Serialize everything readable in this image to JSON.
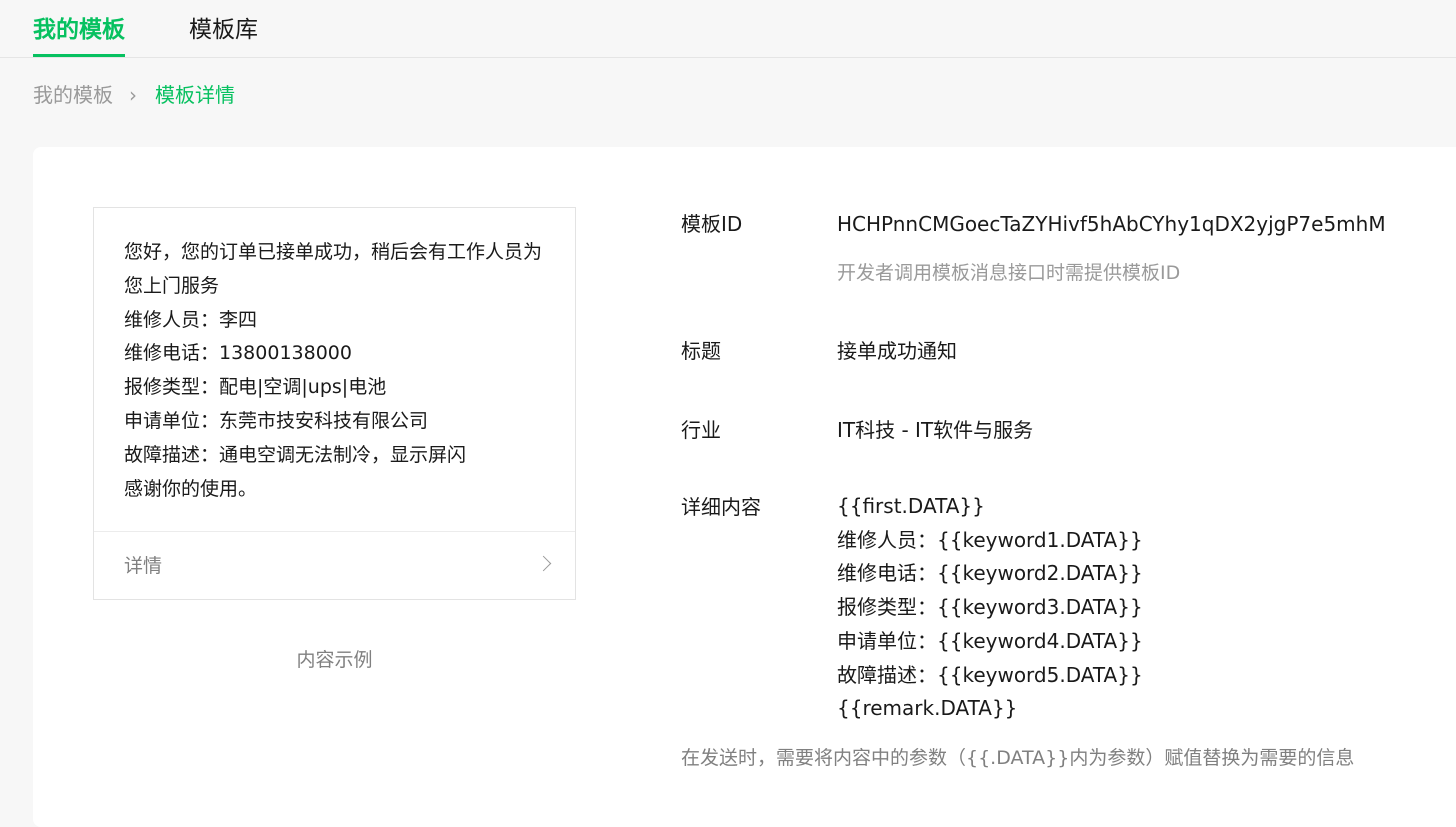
{
  "tabs": [
    {
      "label": "我的模板",
      "active": true
    },
    {
      "label": "模板库",
      "active": false
    }
  ],
  "breadcrumb": {
    "parent": "我的模板",
    "current": "模板详情"
  },
  "preview": {
    "lines": [
      "您好，您的订单已接单成功，稍后会有工作人员为您上门服务",
      "维修人员：李四",
      "维修电话：13800138000",
      "报修类型：配电|空调|ups|电池",
      "申请单位：东莞市技安科技有限公司",
      "故障描述：通电空调无法制冷，显示屏闪",
      "感谢你的使用。"
    ],
    "details_label": "详情",
    "caption": "内容示例"
  },
  "info": {
    "template_id_label": "模板ID",
    "template_id_value": "HCHPnnCMGoecTaZYHivf5hAbCYhy1qDX2yjgP7e5mhM",
    "template_id_hint": "开发者调用模板消息接口时需提供模板ID",
    "title_label": "标题",
    "title_value": "接单成功通知",
    "industry_label": "行业",
    "industry_value": "IT科技 - IT软件与服务",
    "content_label": "详细内容",
    "content_lines": [
      "{{first.DATA}}",
      "维修人员：{{keyword1.DATA}}",
      "维修电话：{{keyword2.DATA}}",
      "报修类型：{{keyword3.DATA}}",
      "申请单位：{{keyword4.DATA}}",
      "故障描述：{{keyword5.DATA}}",
      "{{remark.DATA}}"
    ],
    "footnote": "在发送时，需要将内容中的参数（{{.DATA}}内为参数）赋值替换为需要的信息"
  },
  "colors": {
    "accent": "#07c160",
    "muted": "#9a9a9a",
    "background": "#f7f7f7"
  }
}
